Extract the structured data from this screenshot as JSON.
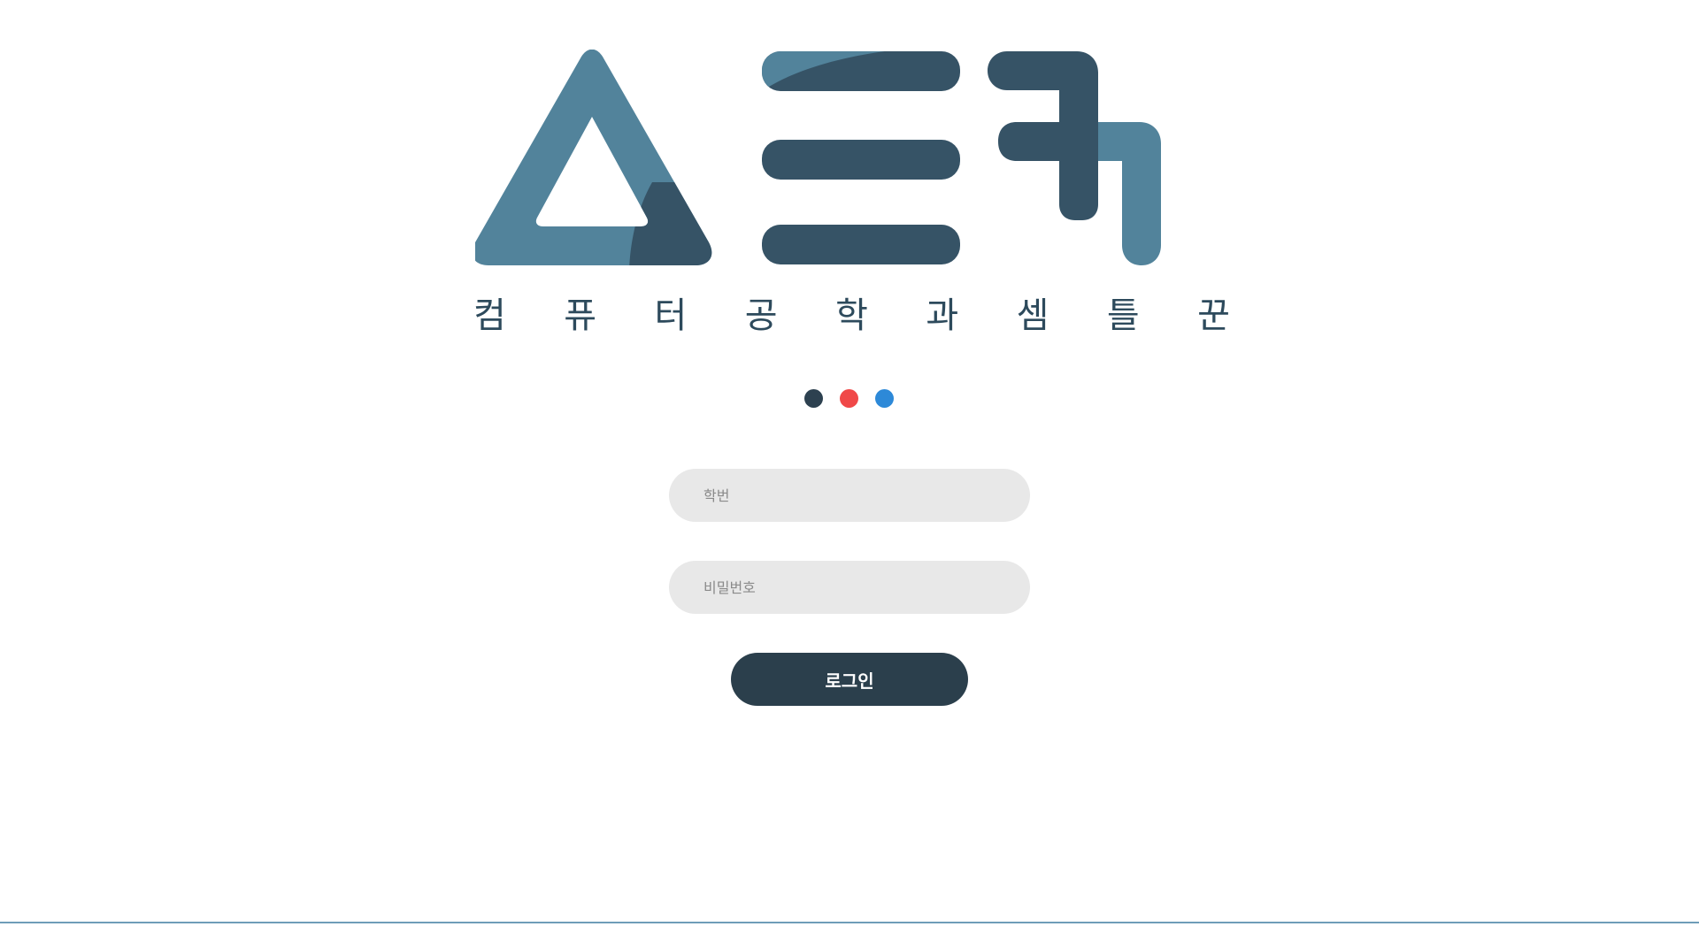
{
  "logo": {
    "alt_name": "ㅅㅌㅋ",
    "colors": {
      "primary": "#52839b",
      "dark": "#365366"
    }
  },
  "tagline": {
    "chars": [
      "컴",
      "퓨",
      "터",
      "공",
      "학",
      "과",
      "셈",
      "틀",
      "꾼"
    ]
  },
  "dots": [
    {
      "name": "dark-dot",
      "color": "#2d4150"
    },
    {
      "name": "red-dot",
      "color": "#f04848"
    },
    {
      "name": "blue-dot",
      "color": "#2d89d8"
    }
  ],
  "login": {
    "student_id": {
      "placeholder": "학번",
      "value": ""
    },
    "password": {
      "placeholder": "비밀번호",
      "value": ""
    },
    "submit_label": "로그인",
    "button_color": "#2b3f4c"
  },
  "footer": {
    "line_color": "#6f9db8"
  }
}
